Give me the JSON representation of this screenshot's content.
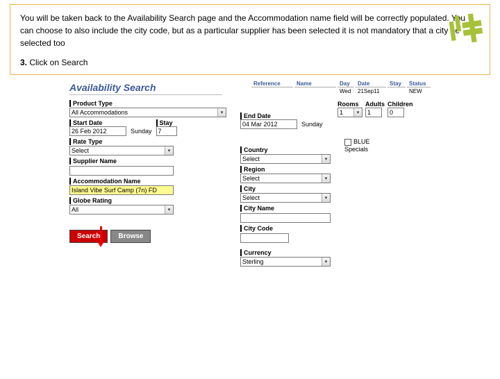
{
  "instruction": {
    "paragraph": "You will be taken back to the Availability Search page and the Accommodation name field will be correctly populated.  You can choose to also include the city code, but as a particular supplier has been selected it is not mandatory that a city be selected too",
    "step_num": "3.",
    "step_text": " Click on Search"
  },
  "page_title": "Availability Search",
  "header": {
    "reference_label": "Reference",
    "name_label": "Name",
    "day_label": "Day",
    "date_label": "Date",
    "stay_label": "Stay",
    "status_label": "Status",
    "day_val": "Wed",
    "date_val": "21Sep11",
    "status_val": "NEW"
  },
  "left": {
    "product_type_label": "Product Type",
    "product_type_val": "All Accommodations",
    "start_date_label": "Start Date",
    "start_date_val": "26 Feb 2012",
    "start_day": "Sunday",
    "stay_label": "Stay",
    "stay_val": "7",
    "rate_type_label": "Rate Type",
    "rate_type_val": "Select",
    "supplier_name_label": "Supplier Name",
    "supplier_name_val": "",
    "accommodation_name_label": "Accommodation Name",
    "accommodation_name_val": "Island Vibe Surf Camp (7n) FD",
    "globe_rating_label": "Globe Rating",
    "globe_rating_val": "All",
    "search_btn": "Search",
    "browse_btn": "Browse"
  },
  "right": {
    "end_date_label": "End Date",
    "end_date_val": "04 Mar 2012",
    "end_day": "Sunday",
    "rooms_label": "Rooms",
    "rooms_val": "1",
    "adults_label": "Adults",
    "adults_val": "1",
    "children_label": "Children",
    "children_val": "0",
    "blue_specials_label": "BLUE Specials",
    "country_label": "Country",
    "country_val": "Select",
    "region_label": "Region",
    "region_val": "Select",
    "city_label": "City",
    "city_val": "Select",
    "city_name_label": "City Name",
    "city_name_val": "",
    "city_code_label": "City Code",
    "city_code_val": "",
    "currency_label": "Currency",
    "currency_val": "Sterling"
  }
}
